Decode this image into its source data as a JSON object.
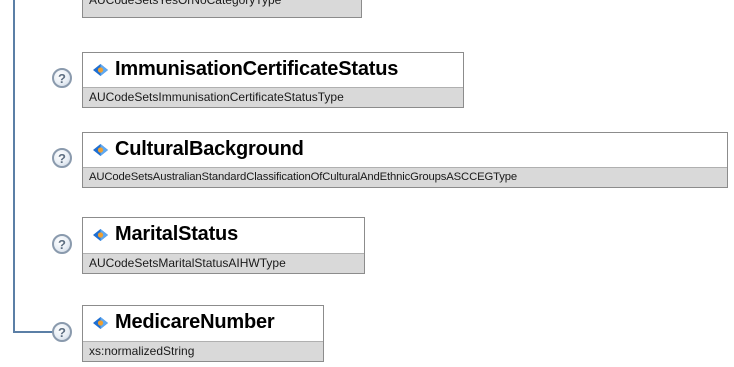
{
  "elements": [
    {
      "name": "",
      "type": "AUCodeSetsYesOrNoCategoryType"
    },
    {
      "name": "ImmunisationCertificateStatus",
      "type": "AUCodeSetsImmunisationCertificateStatusType"
    },
    {
      "name": "CulturalBackground",
      "type": "AUCodeSetsAustralianStandardClassificationOfCulturalAndEthnicGroupsASCCEGType"
    },
    {
      "name": "MaritalStatus",
      "type": "AUCodeSetsMaritalStatusAIHWType"
    },
    {
      "name": "MedicareNumber",
      "type": "xs:normalizedString"
    }
  ],
  "icons": {
    "help": "question-mark-icon",
    "element": "element-diamond-icon",
    "help_glyph": "?"
  },
  "colors": {
    "connector": "#5b7fa6",
    "type_band": "#d9d9d9",
    "box_border": "#8c8c8c",
    "icon_blue": "#1f6fd1",
    "icon_orange": "#f0a030"
  }
}
